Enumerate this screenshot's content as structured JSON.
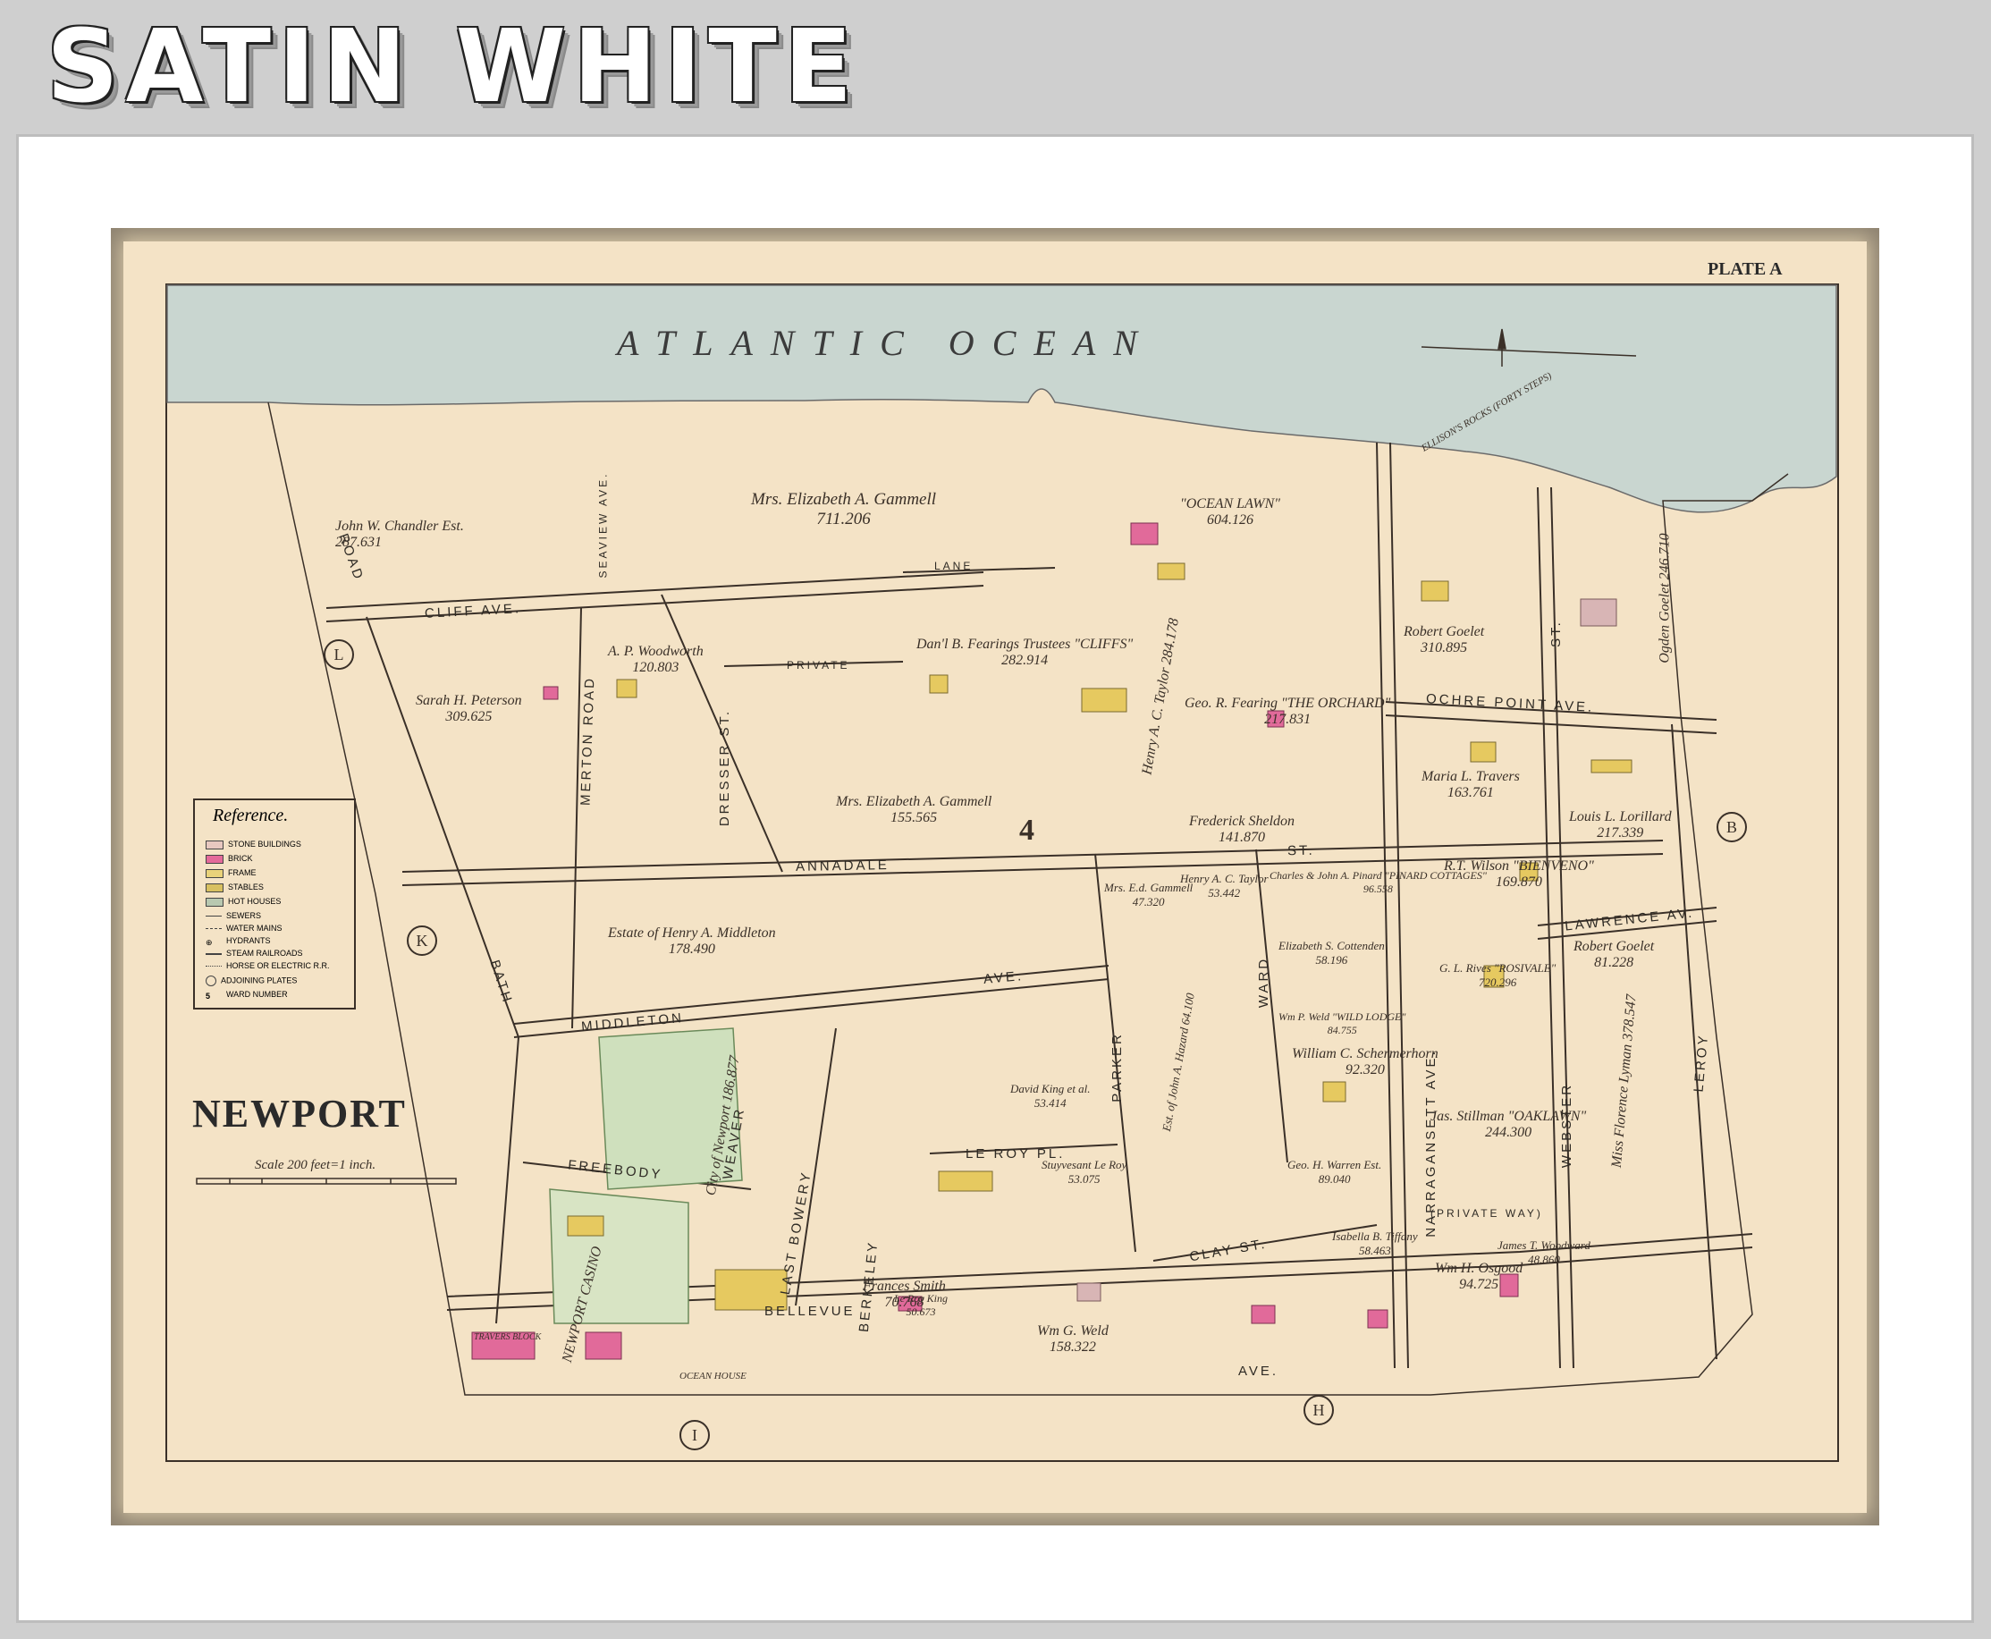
{
  "brand_title": "SATIN WHITE",
  "plate": "PLATE A",
  "ocean": "ATLANTIC OCEAN",
  "city": "NEWPORT",
  "scale_text": "Scale 200 feet=1 inch.",
  "ellisons_rocks": "ELLISON'S ROCKS (FORTY STEPS)",
  "ward_number": "4",
  "reference": {
    "title": "Reference.",
    "items": [
      {
        "label": "STONE BUILDINGS",
        "color": "#e8c8c0"
      },
      {
        "label": "BRICK",
        "color": "#e46a9a"
      },
      {
        "label": "FRAME",
        "color": "#e9d27a"
      },
      {
        "label": "STABLES",
        "color": "#d8c060"
      },
      {
        "label": "HOT HOUSES",
        "color": "#b8c8b0"
      },
      {
        "label": "SEWERS",
        "color": "#444444"
      },
      {
        "label": "WATER MAINS",
        "color": "#444444"
      },
      {
        "label": "HYDRANTS",
        "color": "#444444"
      },
      {
        "label": "STEAM RAILROADS",
        "color": "#444444"
      },
      {
        "label": "HORSE OR ELECTRIC R.R.",
        "color": "#444444"
      },
      {
        "label": "ADJOINING PLATES",
        "color": "#444444"
      },
      {
        "label": "WARD NUMBER",
        "color": "#444444"
      }
    ]
  },
  "plates_circles": [
    "L",
    "K",
    "I",
    "H",
    "B"
  ],
  "streets": {
    "cliff_ave": "CLIFF AVE.",
    "private_lane": "PRIVATE",
    "lane": "LANE",
    "annadale_st": "ANNADALE",
    "st": "ST.",
    "middleton": "MIDDLETON",
    "middleton_ave": "AVE.",
    "freebody": "FREEBODY",
    "leroy_pl": "LE ROY PL.",
    "bellevue": "BELLEVUE",
    "ave": "AVE.",
    "ochre_point_ave": "OCHRE POINT AVE.",
    "lawrence_av": "LAWRENCE AV.",
    "clay_st": "CLAY ST.",
    "private_way": "(PRIVATE WAY)",
    "bath_road": "BATH",
    "road": "ROAD",
    "merton_road": "MERTON ROAD",
    "dresser_st": "DRESSER ST.",
    "seaview_ave": "SEAVIEW AVE.",
    "bowery": "LAST BOWERY",
    "weaver": "WEAVER",
    "berkeley": "BERKELEY",
    "parker": "PARKER",
    "ward": "WARD",
    "narragansett_ave": "NARRAGANSETT AVE.",
    "webster": "WEBSTER",
    "leroy": "LEROY",
    "ochre_st": "ST."
  },
  "owners": [
    {
      "name": "John W. Chandler Est.",
      "area": "287.631"
    },
    {
      "name": "Mrs. Elizabeth A. Gammell",
      "area": "711.206"
    },
    {
      "name": "\"OCEAN LAWN\"",
      "area": "604.126"
    },
    {
      "name": "Robert Goelet",
      "area": "310.895"
    },
    {
      "name": "Ogden Goelet",
      "area": "246.710"
    },
    {
      "name": "Sarah H. Peterson",
      "area": "309.625"
    },
    {
      "name": "A. P. Woodworth",
      "area": "120.803"
    },
    {
      "name": "Dan'l B. Fearings Trustees \"CLIFFS\"",
      "area": "282.914"
    },
    {
      "name": "Henry A. C. Taylor",
      "area": "284.178"
    },
    {
      "name": "Geo. R. Fearing \"THE ORCHARD\"",
      "area": "217.831"
    },
    {
      "name": "Maria L. Travers",
      "area": "163.761"
    },
    {
      "name": "Louis L. Lorillard",
      "area": "217.339"
    },
    {
      "name": "Mrs. Elizabeth A. Gammell",
      "area": "155.565"
    },
    {
      "name": "Frederick Sheldon",
      "area": "141.870"
    },
    {
      "name": "R.T. Wilson \"BIENVENO\"",
      "area": "169.870"
    },
    {
      "name": "Estate of Henry A. Middleton",
      "area": "178.490"
    },
    {
      "name": "Robert Goelet",
      "area": "81.228"
    },
    {
      "name": "Jas. Stillman \"OAKLAWN\"",
      "area": "244.300"
    },
    {
      "name": "Miss Florence Lyman",
      "area": "378.547"
    },
    {
      "name": "William C. Schermerhorn",
      "area": "92.320"
    },
    {
      "name": "Wm G. Weld",
      "area": "158.322"
    },
    {
      "name": "Frances Smith",
      "area": "70.768"
    },
    {
      "name": "OCEAN HOUSE",
      "area": ""
    },
    {
      "name": "NEWPORT CASINO",
      "area": ""
    },
    {
      "name": "City of Newport",
      "area": "186.877"
    },
    {
      "name": "Wm H. Osgood",
      "area": "94.725"
    },
    {
      "name": "James T. Woodward",
      "area": "48.860"
    },
    {
      "name": "Isabella B. Tiffany",
      "area": "58.463"
    },
    {
      "name": "Elizabeth S. Cottenden",
      "area": "58.196"
    },
    {
      "name": "G. L. Rives \"ROSIVALE\"",
      "area": "720.296"
    },
    {
      "name": "Henry A. C. Taylor",
      "area": "53.442"
    },
    {
      "name": "Mrs. E.d. Gammell",
      "area": "47.320"
    },
    {
      "name": "David King et al.",
      "area": "53.414"
    },
    {
      "name": "Stuyvesant Le Roy",
      "area": "53.075"
    },
    {
      "name": "Est. of John A. Hazard",
      "area": "64.100"
    },
    {
      "name": "Geo. H. Warren Est.",
      "area": "89.040"
    },
    {
      "name": "TRAVERS BLOCK",
      "area": ""
    },
    {
      "name": "Charles & John A. Pinard \"PINARD COTTAGES\"",
      "area": "96.558"
    },
    {
      "name": "Wm P. Weld \"WILD LODGE\"",
      "area": "84.755"
    },
    {
      "name": "Le Roy King",
      "area": "50.673"
    }
  ]
}
